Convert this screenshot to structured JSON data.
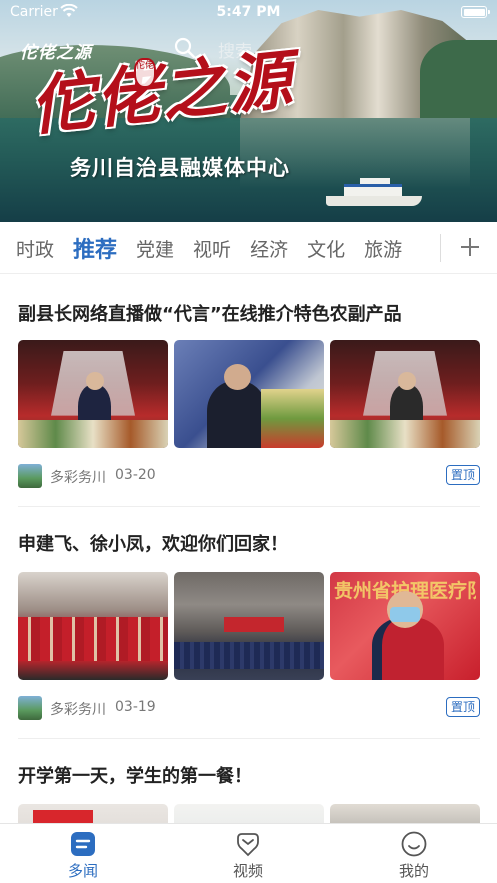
{
  "status_bar": {
    "carrier": "Carrier",
    "time": "5:47 PM"
  },
  "header": {
    "logo_small": "佗佬之源",
    "search_placeholder": "搜索",
    "logo_big": "佗佬之源",
    "logo_seal": "佗佬",
    "subtitle": "务川自治县融媒体中心"
  },
  "tabs": {
    "items": [
      "时政",
      "推荐",
      "党建",
      "视听",
      "经济",
      "文化",
      "旅游"
    ],
    "active_index": 1,
    "add_icon": "plus-icon"
  },
  "articles": [
    {
      "title": "副县长网络直播做“代言”在线推介特色农副产品",
      "source": "多彩务川",
      "date": "03-20",
      "pin_label": "置顶"
    },
    {
      "title": "申建飞、徐小凤，欢迎你们回家！",
      "source": "多彩务川",
      "date": "03-19",
      "pin_label": "置顶",
      "wall_text": "贵州省护理医疗队"
    },
    {
      "title": "开学第一天，学生的第一餐！"
    }
  ],
  "bottom_nav": {
    "items": [
      {
        "label": "多闻",
        "icon": "news-icon"
      },
      {
        "label": "视频",
        "icon": "video-icon"
      },
      {
        "label": "我的",
        "icon": "profile-icon"
      }
    ],
    "active_index": 0
  },
  "colors": {
    "accent": "#2c6dc0",
    "logo_red": "#b40f1a"
  }
}
